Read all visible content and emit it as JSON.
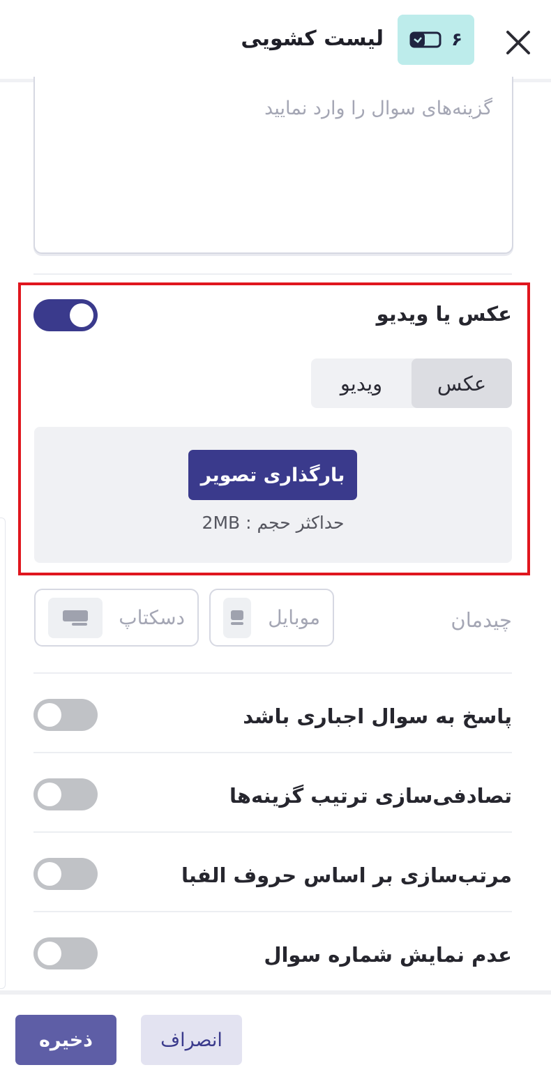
{
  "header": {
    "title": "لیست کشویی",
    "question_number": "۶",
    "question_type_icon": "dropdown-list-icon",
    "close_icon": "close-icon"
  },
  "options_field": {
    "placeholder": "گزینه‌های سوال را وارد نمایید",
    "value": ""
  },
  "media": {
    "label": "عکس یا ویدیو",
    "enabled": true,
    "tabs": [
      "عکس",
      "ویدیو"
    ],
    "selected_tab": "عکس",
    "upload_button": "بارگذاری تصویر",
    "max_size_hint": "حداکثر حجم : 2MB"
  },
  "layout": {
    "label": "چیدمان",
    "options": [
      {
        "label": "موبایل",
        "icon": "mobile-layout-icon"
      },
      {
        "label": "دسکتاپ",
        "icon": "desktop-layout-icon"
      }
    ]
  },
  "settings": [
    {
      "label": "پاسخ به سوال اجباری باشد",
      "enabled": false
    },
    {
      "label": "تصادفی‌سازی ترتیب گزینه‌ها",
      "enabled": false
    },
    {
      "label": "مرتب‌سازی بر اساس حروف الفبا",
      "enabled": false
    },
    {
      "label": "عدم نمایش شماره سوال",
      "enabled": false
    }
  ],
  "footer": {
    "save": "ذخیره",
    "cancel": "انصراف"
  },
  "colors": {
    "primary": "#3a3a8c",
    "badge_bg": "#bdeceb",
    "highlight_border": "#e0161e"
  }
}
